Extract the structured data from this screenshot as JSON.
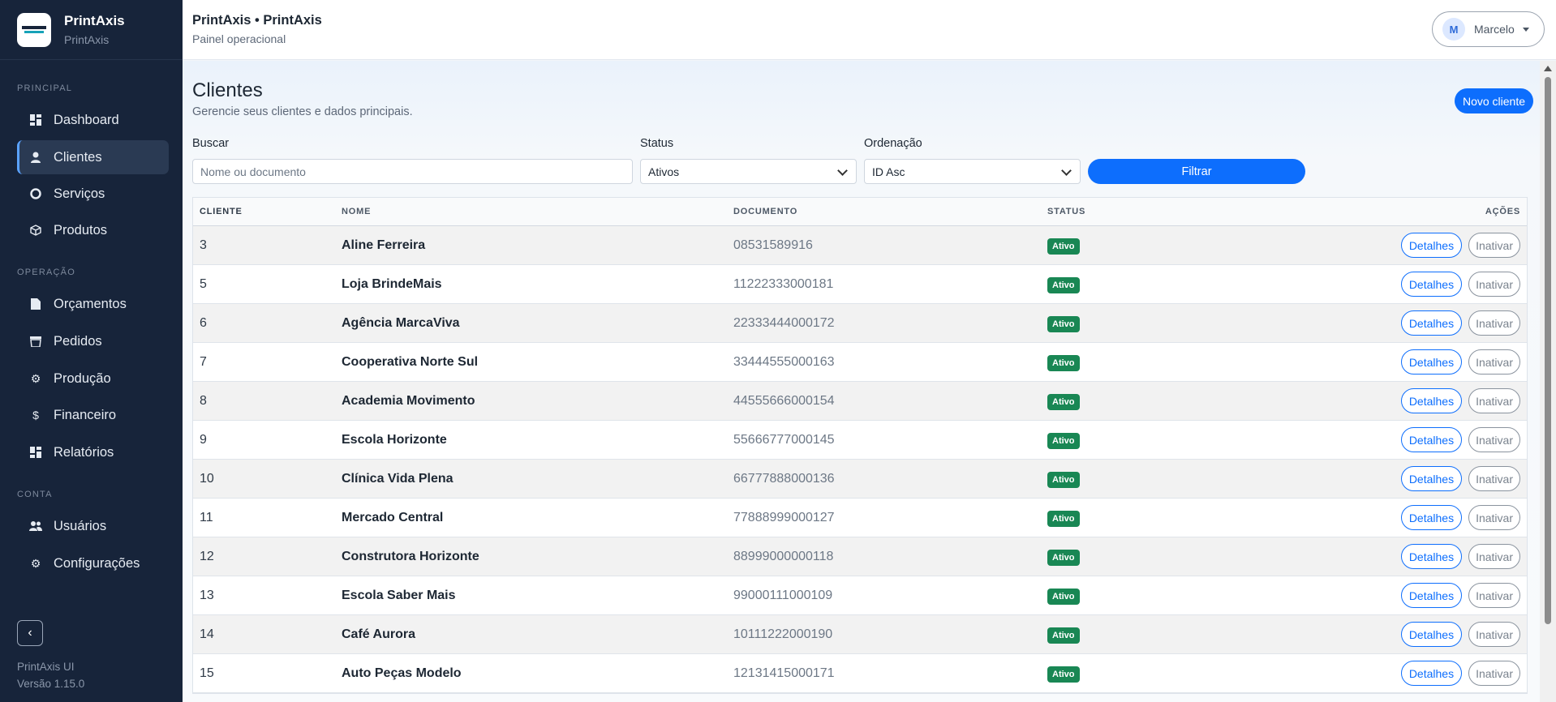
{
  "sidebar": {
    "brand_name": "PrintAxis",
    "brand_sub": "PrintAxis",
    "sections": {
      "principal": "PRINCIPAL",
      "operacao": "OPERAÇÃO",
      "conta": "CONTA"
    },
    "items": [
      {
        "label": "Dashboard",
        "icon": "grid-icon"
      },
      {
        "label": "Clientes",
        "icon": "user-icon"
      },
      {
        "label": "Serviços",
        "icon": "cog-icon"
      },
      {
        "label": "Produtos",
        "icon": "box-icon"
      },
      {
        "label": "Orçamentos",
        "icon": "file-icon"
      },
      {
        "label": "Pedidos",
        "icon": "basket-icon"
      },
      {
        "label": "Produção",
        "icon": "gear-icon"
      },
      {
        "label": "Financeiro",
        "icon": "dollar-icon"
      },
      {
        "label": "Relatórios",
        "icon": "grid-icon"
      },
      {
        "label": "Usuários",
        "icon": "users-icon"
      },
      {
        "label": "Configurações",
        "icon": "gear-icon"
      }
    ],
    "footer_app": "PrintAxis UI",
    "footer_version": "Versão 1.15.0"
  },
  "header": {
    "title": "PrintAxis • PrintAxis",
    "subtitle": "Painel operacional",
    "user_initial": "M",
    "user_name": "Marcelo"
  },
  "page": {
    "title": "Clientes",
    "subtitle": "Gerencie seus clientes e dados principais.",
    "new_button": "Novo cliente"
  },
  "filters": {
    "search_label": "Buscar",
    "search_placeholder": "Nome ou documento",
    "status_label": "Status",
    "status_value": "Ativos",
    "order_label": "Ordenação",
    "order_value": "ID Asc",
    "filter_button": "Filtrar"
  },
  "table": {
    "headers": {
      "cliente": "CLIENTE",
      "nome": "NOME",
      "documento": "DOCUMENTO",
      "status": "STATUS",
      "acoes": "AÇÕES"
    },
    "details_label": "Detalhes",
    "deactivate_label": "Inativar",
    "rows": [
      {
        "id": "3",
        "nome": "Aline Ferreira",
        "documento": "08531589916",
        "status": "Ativo"
      },
      {
        "id": "5",
        "nome": "Loja BrindeMais",
        "documento": "11222333000181",
        "status": "Ativo"
      },
      {
        "id": "6",
        "nome": "Agência MarcaViva",
        "documento": "22333444000172",
        "status": "Ativo"
      },
      {
        "id": "7",
        "nome": "Cooperativa Norte Sul",
        "documento": "33444555000163",
        "status": "Ativo"
      },
      {
        "id": "8",
        "nome": "Academia Movimento",
        "documento": "44555666000154",
        "status": "Ativo"
      },
      {
        "id": "9",
        "nome": "Escola Horizonte",
        "documento": "55666777000145",
        "status": "Ativo"
      },
      {
        "id": "10",
        "nome": "Clínica Vida Plena",
        "documento": "66777888000136",
        "status": "Ativo"
      },
      {
        "id": "11",
        "nome": "Mercado Central",
        "documento": "77888999000127",
        "status": "Ativo"
      },
      {
        "id": "12",
        "nome": "Construtora Horizonte",
        "documento": "88999000000118",
        "status": "Ativo"
      },
      {
        "id": "13",
        "nome": "Escola Saber Mais",
        "documento": "99000111000109",
        "status": "Ativo"
      },
      {
        "id": "14",
        "nome": "Café Aurora",
        "documento": "10111222000190",
        "status": "Ativo"
      },
      {
        "id": "15",
        "nome": "Auto Peças Modelo",
        "documento": "12131415000171",
        "status": "Ativo"
      }
    ]
  }
}
